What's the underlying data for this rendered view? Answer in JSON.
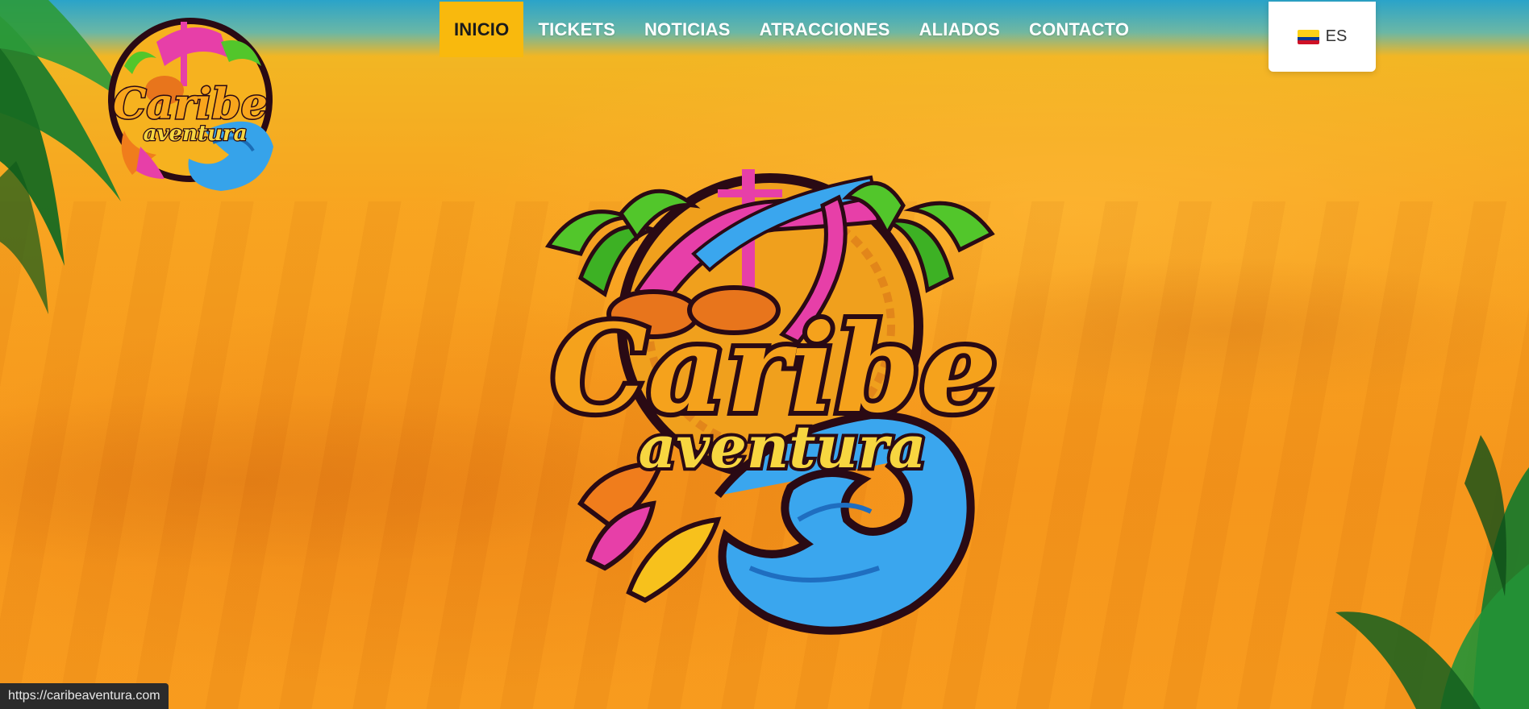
{
  "nav": {
    "items": [
      {
        "label": "INICIO",
        "active": true
      },
      {
        "label": "TICKETS",
        "active": false
      },
      {
        "label": "NOTICIAS",
        "active": false
      },
      {
        "label": "ATRACCIONES",
        "active": false
      },
      {
        "label": "ALIADOS",
        "active": false
      },
      {
        "label": "CONTACTO",
        "active": false
      }
    ],
    "active_bg": "#f9b90d"
  },
  "language": {
    "code": "ES",
    "flag": "colombia-flag-icon"
  },
  "logo": {
    "line1": "Caribe",
    "line2": "aventura"
  },
  "status_bar": {
    "url": "https://caribeaventura.com"
  }
}
